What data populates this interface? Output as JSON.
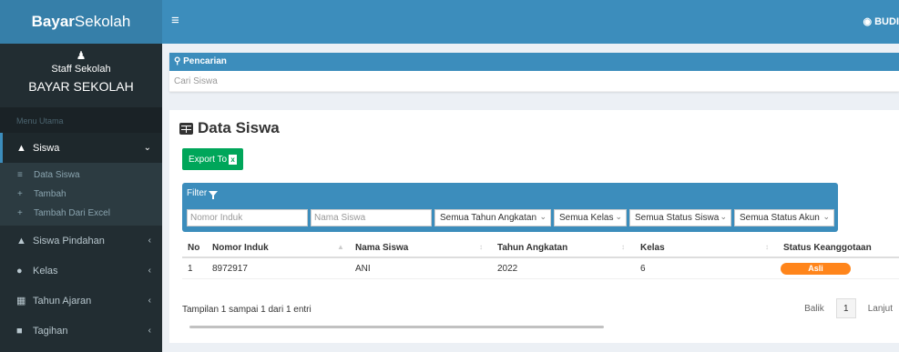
{
  "brand": {
    "bold": "Bayar",
    "rest": "Sekolah"
  },
  "user": {
    "role": "Staff Sekolah",
    "org": "BAYAR SEKOLAH",
    "top_name": "BUDI"
  },
  "menu": {
    "header": "Menu Utama",
    "siswa": "Siswa",
    "sub": [
      "Data Siswa",
      "Tambah",
      "Tambah Dari Excel"
    ],
    "items": [
      "Siswa Pindahan",
      "Kelas",
      "Tahun Ajaran",
      "Tagihan"
    ]
  },
  "search": {
    "title": "Pencarian",
    "placeholder": "Cari Siswa"
  },
  "page": {
    "title": "Data Siswa",
    "export_label": "Export To"
  },
  "filter": {
    "label": "Filter",
    "nomor_placeholder": "Nomor Induk",
    "nama_placeholder": "Nama Siswa",
    "tahun": "Semua Tahun Angkatan",
    "kelas": "Semua Kelas",
    "status_siswa": "Semua Status Siswa",
    "status_akun": "Semua Status Akun"
  },
  "table": {
    "headers": [
      "No",
      "Nomor Induk",
      "Nama Siswa",
      "Tahun Angkatan",
      "Kelas",
      "Status Keanggotaan"
    ],
    "rows": [
      {
        "no": "1",
        "nomor": "8972917",
        "nama": "ANI",
        "tahun": "2022",
        "kelas": "6",
        "status": "Asli"
      }
    ]
  },
  "footer": {
    "info": "Tampilan 1 sampai 1 dari 1 entri",
    "prev": "Balik",
    "page": "1",
    "next": "Lanjut"
  },
  "colors": {
    "primary": "#3c8dbc",
    "sidebar": "#222d32",
    "success": "#00a65a",
    "badge": "#ff851b"
  }
}
